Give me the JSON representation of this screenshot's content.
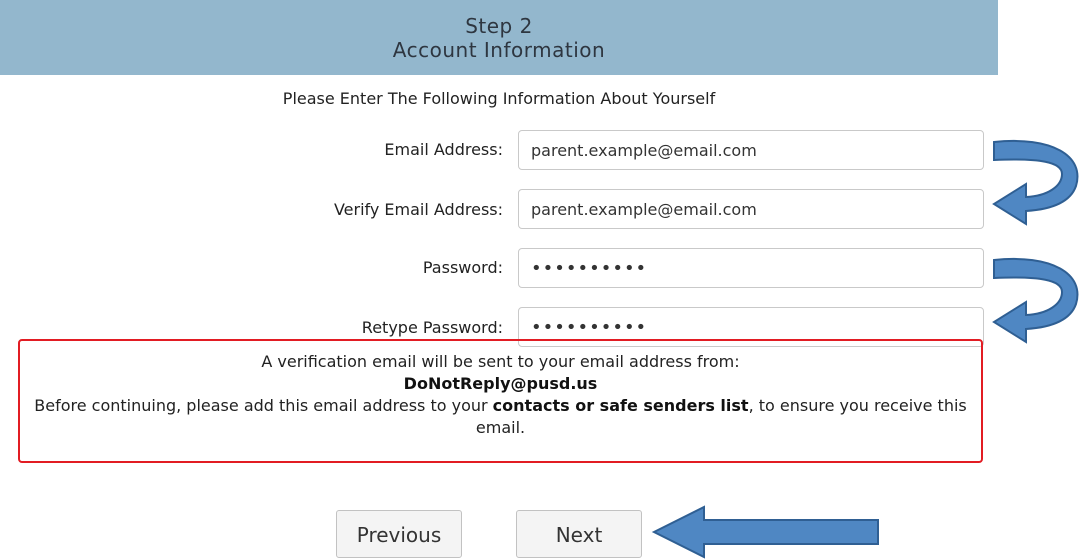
{
  "header": {
    "line1": "Step 2",
    "line2": "Account Information"
  },
  "intro": "Please Enter The Following Information About Yourself",
  "fields": {
    "email": {
      "label": "Email Address:",
      "value": "parent.example@email.com"
    },
    "verify_email": {
      "label": "Verify Email Address:",
      "value": "parent.example@email.com"
    },
    "password": {
      "label": "Password:",
      "value": "••••••••••"
    },
    "retype_password": {
      "label": "Retype Password:",
      "value": "••••••••••"
    }
  },
  "notice": {
    "line1": "A verification email will be sent to your email address from:",
    "sender": "DoNotReply@pusd.us",
    "line3_prefix": "Before continuing, please add this email address to your ",
    "line3_bold": "contacts or safe senders list",
    "line3_suffix": ", to ensure you receive this email."
  },
  "buttons": {
    "previous": "Previous",
    "next": "Next"
  },
  "colors": {
    "header_bg": "#93b7cd",
    "notice_border": "#e21c23",
    "arrow_fill": "#4f87c3",
    "arrow_stroke": "#2f5f93"
  }
}
